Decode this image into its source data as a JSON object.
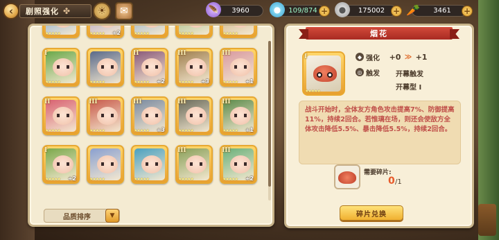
{
  "topbar": {
    "back_glyph": "‹",
    "title": "剧照强化",
    "clover_glyph": "✤",
    "icon_a": "☀",
    "icon_b": "✉",
    "resources": [
      {
        "icon": "🪶",
        "icon_name": "feather-icon",
        "value": "3960"
      },
      {
        "icon": "●",
        "icon_name": "stamina-icon",
        "value": "109/874"
      },
      {
        "icon": "●",
        "icon_name": "silver-coin-icon",
        "value": "175002"
      },
      {
        "icon": "🥕",
        "icon_name": "carrot-icon",
        "value": "3461"
      }
    ],
    "plus_glyph": "+"
  },
  "grid": {
    "cards": [
      {
        "roman": "",
        "plus": "",
        "art": "#6a9ad0"
      },
      {
        "roman": "",
        "plus": "+2",
        "art": "#a090c0"
      },
      {
        "roman": "",
        "plus": "",
        "art": "#7aa0c8"
      },
      {
        "roman": "",
        "plus": "",
        "art": "#8ab070"
      },
      {
        "roman": "",
        "plus": "",
        "art": "#c0a070"
      },
      {
        "roman": "I",
        "plus": "",
        "art": "#6aa84a"
      },
      {
        "roman": "",
        "plus": "",
        "art": "#5a6a8a"
      },
      {
        "roman": "II",
        "plus": "+2",
        "art": "#8a5a7a"
      },
      {
        "roman": "III",
        "plus": "+3",
        "art": "#a08050"
      },
      {
        "roman": "III",
        "plus": "+1",
        "art": "#d89aa0"
      },
      {
        "roman": "II",
        "plus": "",
        "art": "#d86070"
      },
      {
        "roman": "III",
        "plus": "",
        "art": "#c85a4a"
      },
      {
        "roman": "III",
        "plus": "+3",
        "art": "#7a8aa0"
      },
      {
        "roman": "III",
        "plus": "",
        "art": "#6a6a5a"
      },
      {
        "roman": "III",
        "plus": "+1",
        "art": "#5a8a4a"
      },
      {
        "roman": "I",
        "plus": "+2",
        "art": "#7aa84a"
      },
      {
        "roman": "",
        "plus": "",
        "art": "#8aa0d0"
      },
      {
        "roman": "",
        "plus": "",
        "art": "#4aa0c0"
      },
      {
        "roman": "III",
        "plus": "",
        "art": "#8aa05a"
      },
      {
        "roman": "III",
        "plus": "+2",
        "art": "#6ab07a"
      }
    ],
    "stars": "★★★★★",
    "sort_label": "品质排序",
    "sort_chevron": "▼"
  },
  "detail": {
    "title": "烟花",
    "card_roman": "I",
    "card_stars": "★★★★★",
    "enhance": {
      "label": "强化",
      "icon": "◆",
      "from": "+0",
      "arrow": "≫",
      "to": "+1"
    },
    "trigger": {
      "label": "触发",
      "icon": "◎",
      "value1": "开幕触发",
      "value2": "开幕型 I"
    },
    "description": "战斗开始时，全体友方角色攻击提高7%、防御提高11%，持续2回合。若惟璃在场，则还会使敌方全体攻击降低5.5%、暴击降低5.5%，持续2回合。",
    "fragment_label": "需要碎片:",
    "fragment_have": "0",
    "fragment_need": "/1",
    "exchange_label": "碎片兑换"
  }
}
